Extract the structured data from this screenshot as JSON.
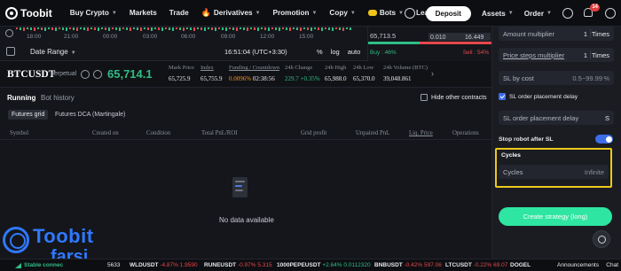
{
  "nav": {
    "logo": "Toobit",
    "items": [
      "Buy Crypto",
      "Markets",
      "Trade",
      "Derivatives",
      "Promotion",
      "Copy",
      "Bots",
      "Learn"
    ],
    "deposit": "Deposit",
    "assets": "Assets",
    "order": "Order",
    "notif_count": "14"
  },
  "chart": {
    "times": [
      "18:00",
      "21:00",
      "00:00",
      "03:00",
      "06:00",
      "09:00",
      "12:00",
      "15:00"
    ],
    "date_range": "Date Range",
    "clock": "16:51:04 (UTC+3:30)",
    "opts": [
      "%",
      "log",
      "auto"
    ]
  },
  "orderbook": {
    "price": "65,713.5",
    "row_a": "0.010",
    "row_b": "16.449",
    "buy_pct": "Buy : 46%",
    "sell_pct": "Sell : 54%"
  },
  "ticker": {
    "symbol": "BTCUSDT",
    "type": "perpetual",
    "last_price": "65,714.1",
    "stats": [
      {
        "label": "Mark Price",
        "value": "65,725.9"
      },
      {
        "label": "Index",
        "value": "65,755.9"
      },
      {
        "label": "Funding / Countdown",
        "value_a": "0.0096%",
        "value_b": "02:38:56"
      },
      {
        "label": "24h Change",
        "value": "229.7 +0.35%"
      },
      {
        "label": "24h High",
        "value": "65,988.0"
      },
      {
        "label": "24h Low",
        "value": "65,370.0"
      },
      {
        "label": "24h Volume (BTC)",
        "value": "39,048.861"
      }
    ]
  },
  "tabs": {
    "running": "Running",
    "history": "Bot history",
    "hide_other": "Hide other contracts",
    "sub": [
      "Futures grid",
      "Futures DCA (Martingale)"
    ]
  },
  "table": {
    "headers": [
      "Symbol",
      "Created on",
      "Condition",
      "Total PnL/ROI",
      "Grid profit",
      "Unpaired PnL",
      "Liq. Price",
      "Operations"
    ],
    "empty": "No data available"
  },
  "panel": {
    "amount_multiplier": {
      "label": "Amount multiplier",
      "value": "1",
      "unit": "Times"
    },
    "price_steps_multiplier": {
      "label": "Price steps multiplier",
      "value": "1",
      "unit": "Times"
    },
    "sl_by_cost": {
      "label": "SL by cost",
      "placeholder": "0.5~99.99",
      "unit": "%"
    },
    "sl_order_delay": "SL order placement delay",
    "sl_order_delay_field": {
      "label": "SL order placement delay",
      "unit": "S"
    },
    "stop_robot": "Stop robot after SL",
    "cycles": {
      "title": "Cycles",
      "label": "Cycles",
      "value": "Infinite"
    },
    "create": "Create strategy (long)"
  },
  "bottom": {
    "stable": "Stable connec",
    "tickers": [
      {
        "sym": "WLDUSDT",
        "chg": "-4.87%",
        "price": "1.9590",
        "dir": "n"
      },
      {
        "sym": "RUNEUSDT",
        "chg": "-0.97%",
        "price": "5.315",
        "dir": "n"
      },
      {
        "sym": "1000PEPEUSDT",
        "chg": "+2.64%",
        "price": "0.0112320",
        "dir": "p"
      },
      {
        "sym": "BNBUSDT",
        "chg": "-0.42%",
        "price": "597.06",
        "dir": "n"
      },
      {
        "sym": "LTCUSDT",
        "chg": "-0.22%",
        "price": "69.07",
        "dir": "n"
      },
      {
        "sym": "DOGEL",
        "chg": "",
        "price": "",
        "dir": "n"
      }
    ],
    "partial_price": "5633",
    "announcements": "Announcements",
    "chat": "Chat"
  },
  "watermark": {
    "line1": "Toobit",
    "line2": "farsi"
  },
  "colors": {
    "green": "#2fbd85",
    "red": "#e5484d",
    "accent": "#2ee6a1",
    "highlight": "#ecc91c",
    "blue": "#3d6de8"
  }
}
